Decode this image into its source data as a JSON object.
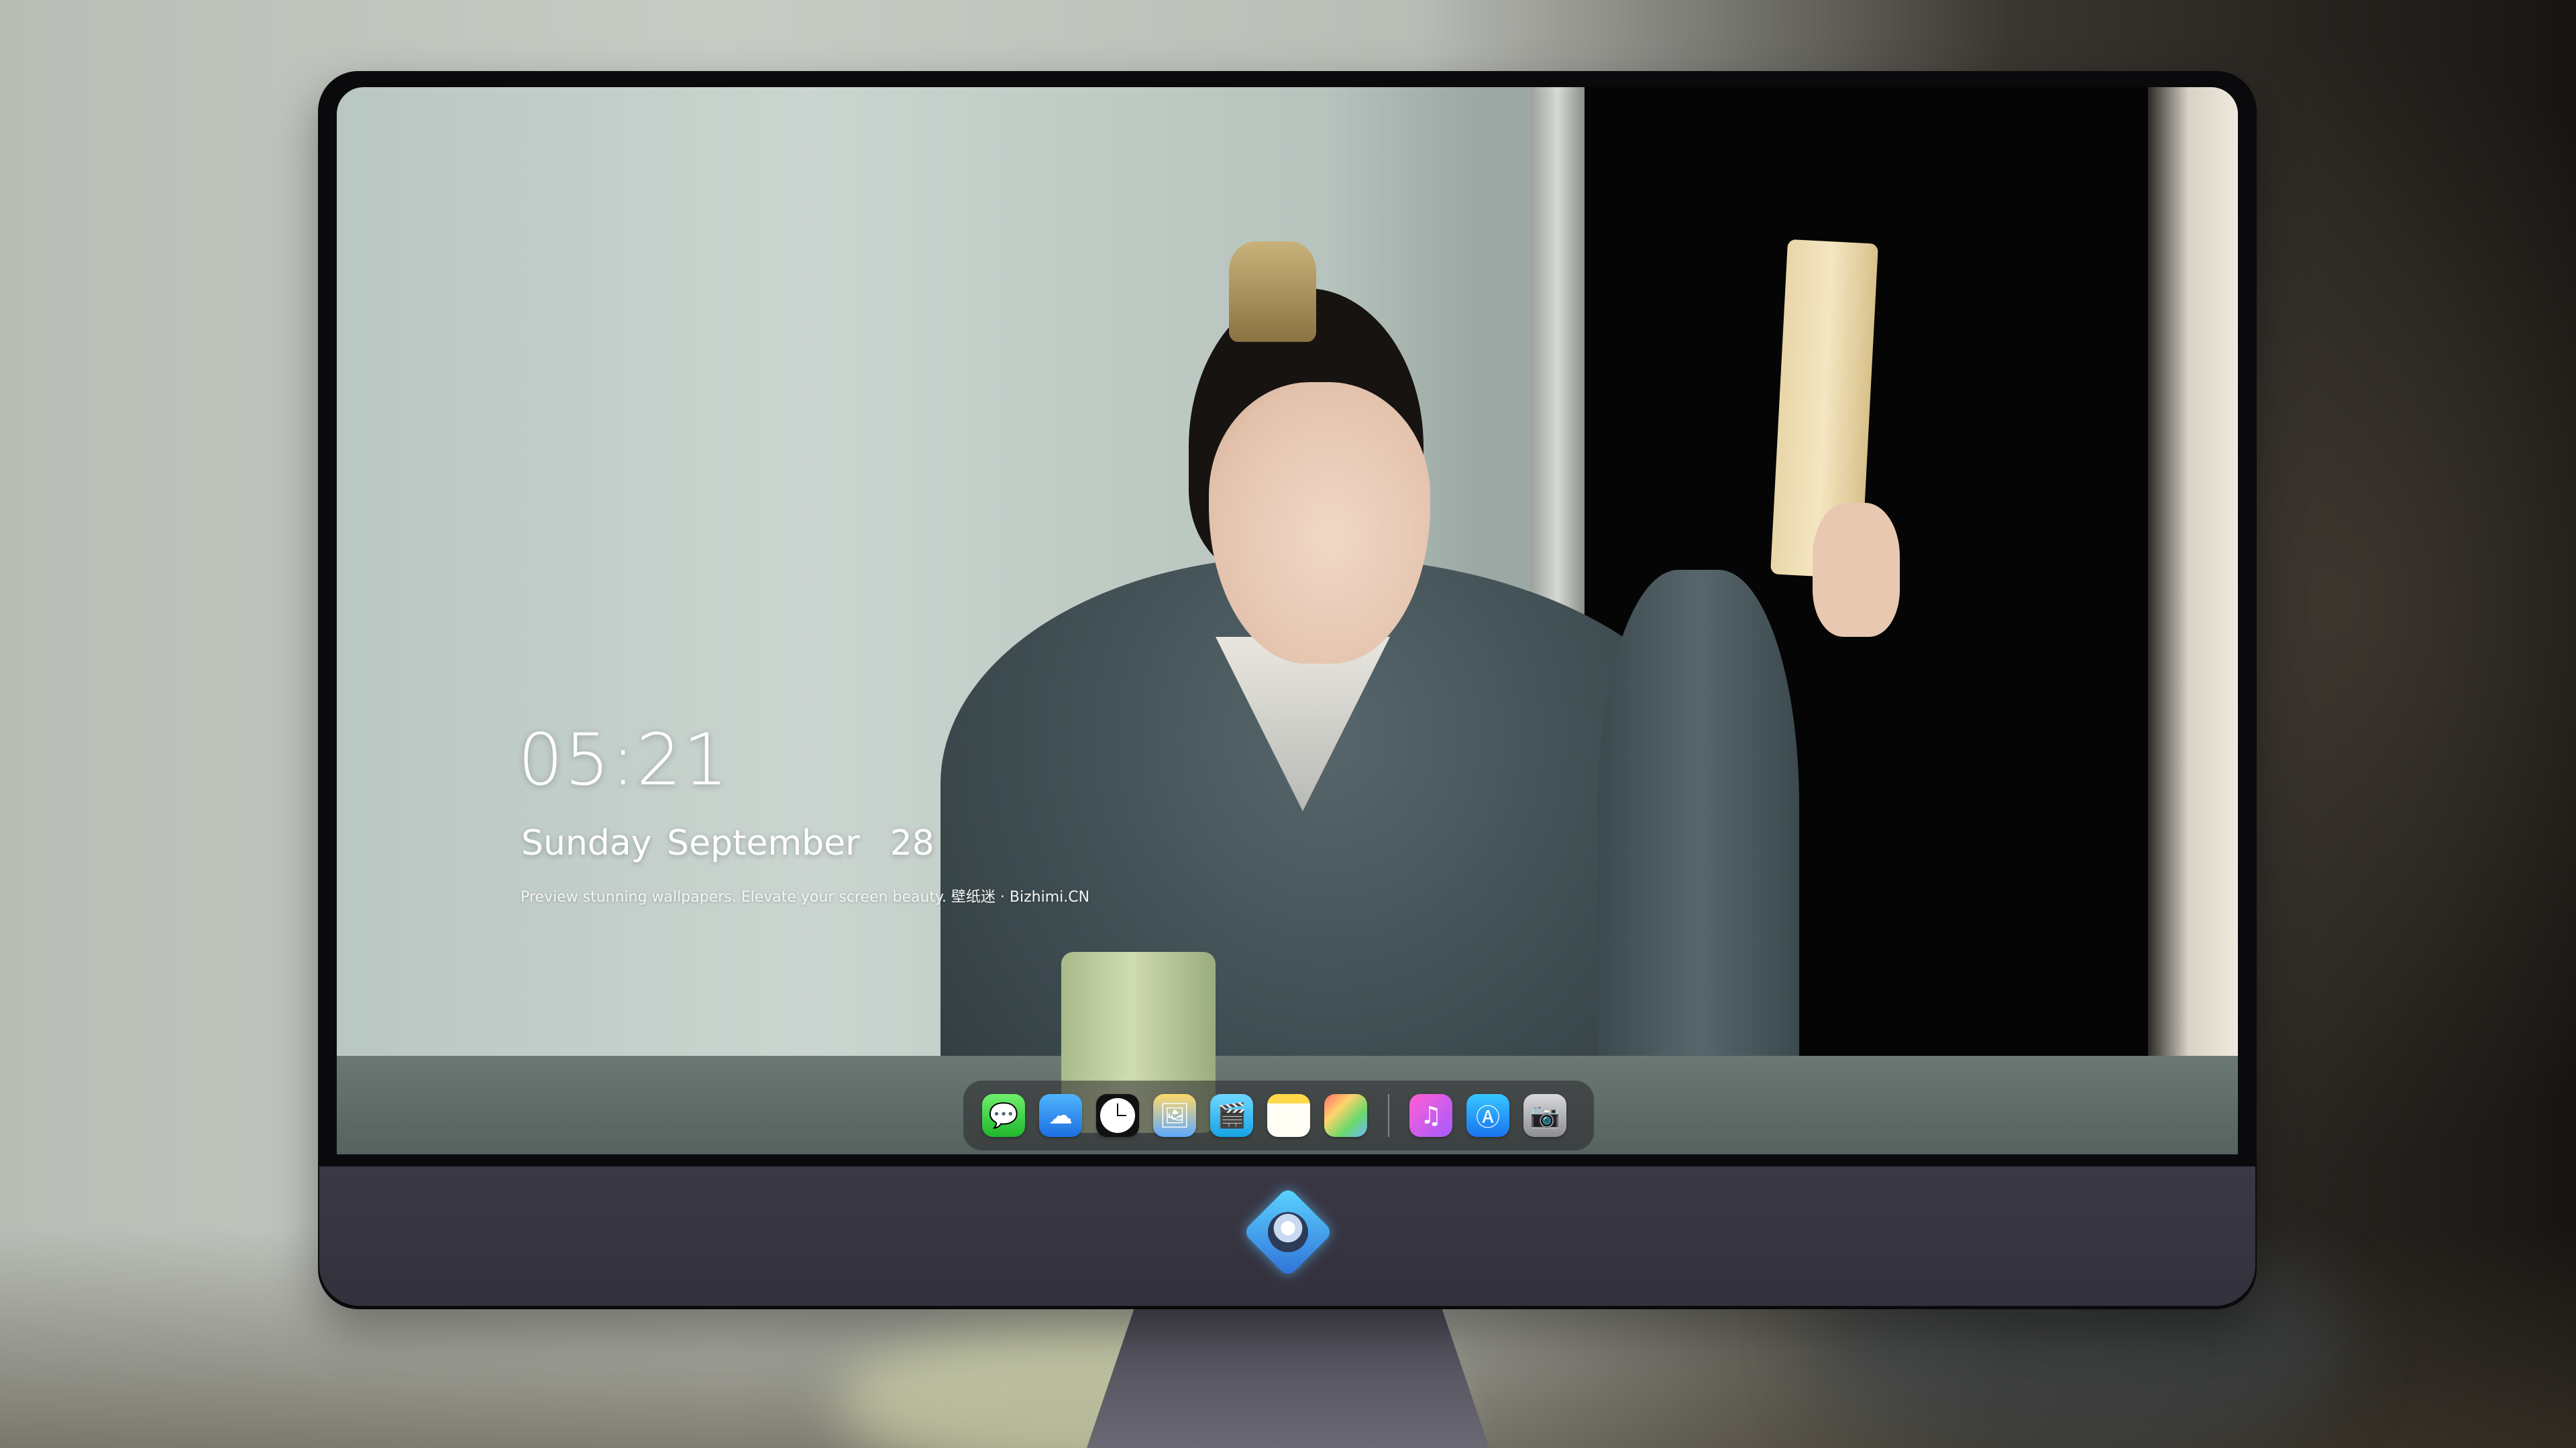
{
  "lockscreen": {
    "time": "05:21",
    "date": "Sunday September  28",
    "tagline": "Preview stunning wallpapers. Elevate your screen beauty. 壁纸迷 · Bizhimi.CN"
  },
  "dock": {
    "apps": [
      {
        "name": "messages-icon",
        "glyph": "💬"
      },
      {
        "name": "weather-icon",
        "glyph": "☁"
      },
      {
        "name": "clock-icon",
        "glyph": ""
      },
      {
        "name": "preview-icon",
        "glyph": "🖼"
      },
      {
        "name": "clips-icon",
        "glyph": "🎬"
      },
      {
        "name": "notes-icon",
        "glyph": ""
      },
      {
        "name": "photos-icon",
        "glyph": ""
      },
      {
        "name": "itunes-icon",
        "glyph": "♫"
      },
      {
        "name": "app-store-icon",
        "glyph": "Ⓐ"
      },
      {
        "name": "camera-icon",
        "glyph": "📷"
      }
    ]
  },
  "colors": {
    "bezel": "#0a0a0c",
    "chin": "#3b3845",
    "clock_text": "#ffffff"
  }
}
